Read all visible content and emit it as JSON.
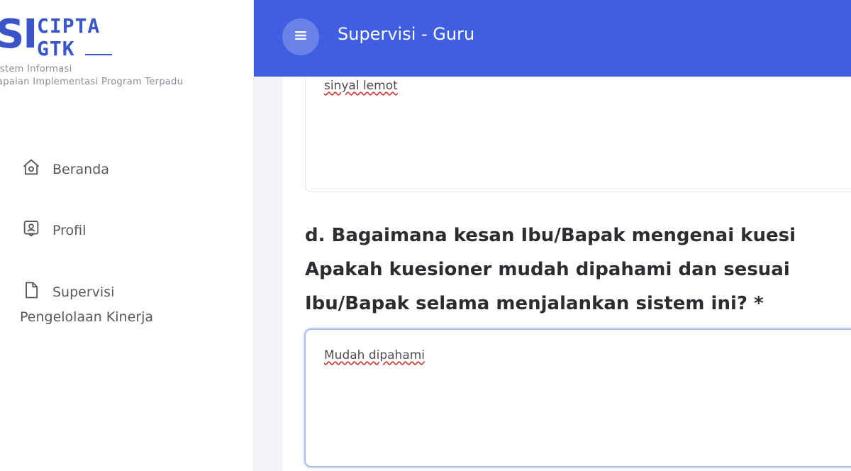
{
  "logo": {
    "mark": "SI",
    "line1": "CIPTA",
    "line2": "GTK",
    "sub1": "istem Informasi",
    "sub2": "apaian Implementasi Program Terpadu"
  },
  "sidebar": {
    "items": [
      {
        "label": "Beranda",
        "icon": "home-icon"
      },
      {
        "label": "Profil",
        "icon": "profile-badge-icon"
      },
      {
        "label": "Supervisi",
        "icon": "document-icon"
      }
    ],
    "sub_label": "Pengelolaan Kinerja"
  },
  "topbar": {
    "title": "Supervisi - Guru",
    "color": "#3f5fe0"
  },
  "form": {
    "previous_answer": "sinyal lemot",
    "question_lines": [
      "d. Bagaimana kesan Ibu/Bapak mengenai kuesi",
      "Apakah kuesioner mudah dipahami dan sesuai",
      "Ibu/Bapak selama menjalankan sistem ini? *"
    ],
    "current_answer": "Mudah dipahami"
  }
}
